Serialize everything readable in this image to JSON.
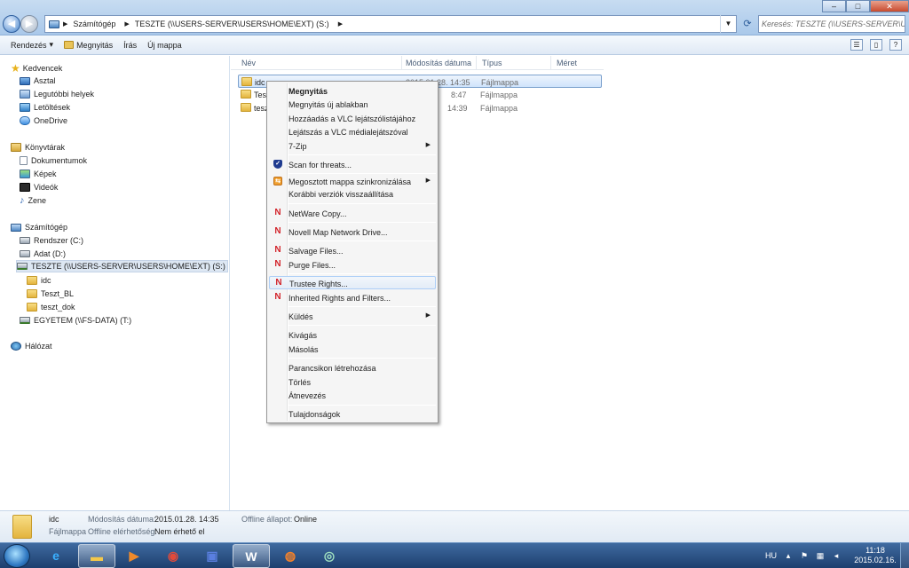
{
  "window": {
    "controls": [
      "–",
      "□",
      "✕"
    ]
  },
  "address": {
    "crumbs": [
      "Számítógép",
      "TESZTE (\\\\USERS-SERVER\\USERS\\HOME\\EXT) (S:)"
    ],
    "search_placeholder": "Keresés: TESZTE (\\\\USERS-SERVER\\US..."
  },
  "toolbar": {
    "organize": "Rendezés",
    "open": "Megnyitás",
    "burn": "Írás",
    "new_folder": "Új mappa"
  },
  "nav": {
    "favorites": {
      "label": "Kedvencek",
      "items": [
        "Asztal",
        "Legutóbbi helyek",
        "Letöltések",
        "OneDrive"
      ]
    },
    "libraries": {
      "label": "Könyvtárak",
      "items": [
        "Dokumentumok",
        "Képek",
        "Videók",
        "Zene"
      ]
    },
    "computer": {
      "label": "Számítógép",
      "drives": [
        "Rendszer (C:)",
        "Adat (D:)",
        "TESZTE (\\\\USERS-SERVER\\USERS\\HOME\\EXT) (S:)"
      ],
      "subfolders": [
        "idc",
        "Teszt_BL",
        "teszt_dok"
      ],
      "drives2": [
        "EGYETEM (\\\\FS-DATA) (T:)"
      ]
    },
    "network": {
      "label": "Hálózat"
    }
  },
  "columns": [
    "Név",
    "Módosítás dátuma",
    "Típus",
    "Méret"
  ],
  "files": [
    {
      "name": "idc",
      "date": "2015.01.28. 14:35",
      "type": "Fájlmappa"
    },
    {
      "name": "Tesz",
      "date": "8:47",
      "type": "Fájlmappa"
    },
    {
      "name": "tesz",
      "date": "14:39",
      "type": "Fájlmappa"
    }
  ],
  "context_menu": {
    "open": "Megnyitás",
    "open_new_window": "Megnyitás új ablakban",
    "vlc_add": "Hozzáadás a VLC lejátszólistájához",
    "vlc_play": "Lejátszás a VLC médialejátszóval",
    "sevenzip": "7-Zip",
    "scan": "Scan for threats...",
    "share_sync": "Megosztott mappa szinkronizálása",
    "restore": "Korábbi verziók visszaállítása",
    "netware_copy": "NetWare Copy...",
    "novell_map": "Novell Map Network Drive...",
    "salvage": "Salvage Files...",
    "purge": "Purge Files...",
    "trustee": "Trustee Rights...",
    "inherited": "Inherited Rights and Filters...",
    "send_to": "Küldés",
    "cut": "Kivágás",
    "copy": "Másolás",
    "shortcut": "Parancsikon létrehozása",
    "delete": "Törlés",
    "rename": "Átnevezés",
    "properties": "Tulajdonságok"
  },
  "details": {
    "name": "idc",
    "type": "Fájlmappa",
    "modified_label": "Módosítás dátuma:",
    "modified_value": "2015.01.28. 14:35",
    "offline_avail_label": "Offline elérhetőség:",
    "offline_avail_value": "Nem érhető el",
    "offline_status_label": "Offline állapot:",
    "offline_status_value": "Online"
  },
  "taskbar": {
    "lang": "HU",
    "time": "11:18",
    "date": "2015.02.16.",
    "word_label": "W"
  }
}
